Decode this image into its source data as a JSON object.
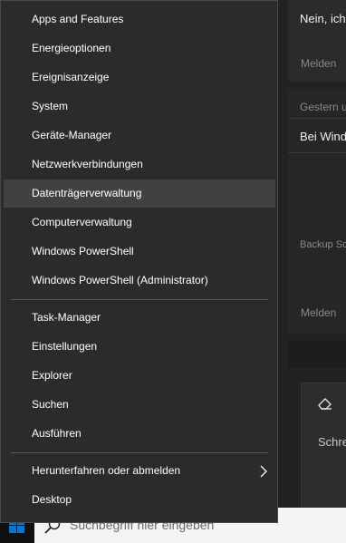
{
  "background_app": {
    "top_text": "Nein, ich",
    "melden_1": "Melden",
    "gestern": "Gestern u",
    "bei_wind": "Bei Wind",
    "backup": "Backup Sc",
    "melden_2": "Melden",
    "schre": "Schre"
  },
  "taskbar": {
    "search_placeholder": "Suchbegriff hier eingeben"
  },
  "menu": {
    "group1": [
      {
        "label": "Apps and Features"
      },
      {
        "label": "Energieoptionen"
      },
      {
        "label": "Ereignisanzeige"
      },
      {
        "label": "System"
      },
      {
        "label": "Geräte-Manager"
      },
      {
        "label": "Netzwerkverbindungen"
      },
      {
        "label": "Datenträgerverwaltung"
      },
      {
        "label": "Computerverwaltung"
      },
      {
        "label": "Windows PowerShell"
      },
      {
        "label": "Windows PowerShell (Administrator)"
      }
    ],
    "group2": [
      {
        "label": "Task-Manager"
      },
      {
        "label": "Einstellungen"
      },
      {
        "label": "Explorer"
      },
      {
        "label": "Suchen"
      },
      {
        "label": "Ausführen"
      }
    ],
    "group3": [
      {
        "label": "Herunterfahren oder abmelden"
      },
      {
        "label": "Desktop"
      }
    ]
  },
  "colors": {
    "menu_bg": "#2b2b2b",
    "highlight": "#414141",
    "start_blue": "#0078d7"
  }
}
